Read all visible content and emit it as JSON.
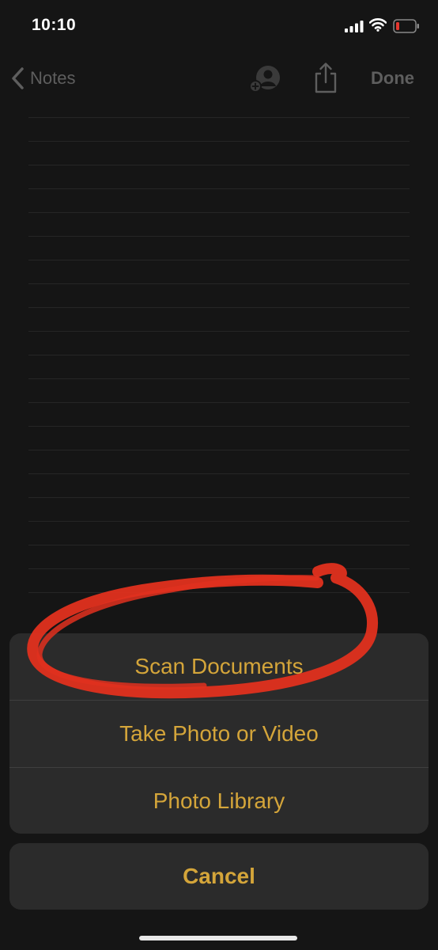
{
  "status_bar": {
    "time": "10:10",
    "battery_color": "#e5372f"
  },
  "nav": {
    "back_label": "Notes",
    "done_label": "Done"
  },
  "action_sheet": {
    "items": [
      {
        "label": "Scan Documents"
      },
      {
        "label": "Take Photo or Video"
      },
      {
        "label": "Photo Library"
      }
    ],
    "cancel_label": "Cancel"
  },
  "colors": {
    "accent": "#d4a53a",
    "annotation": "#e0301e",
    "inactive": "#5e5e5e"
  }
}
